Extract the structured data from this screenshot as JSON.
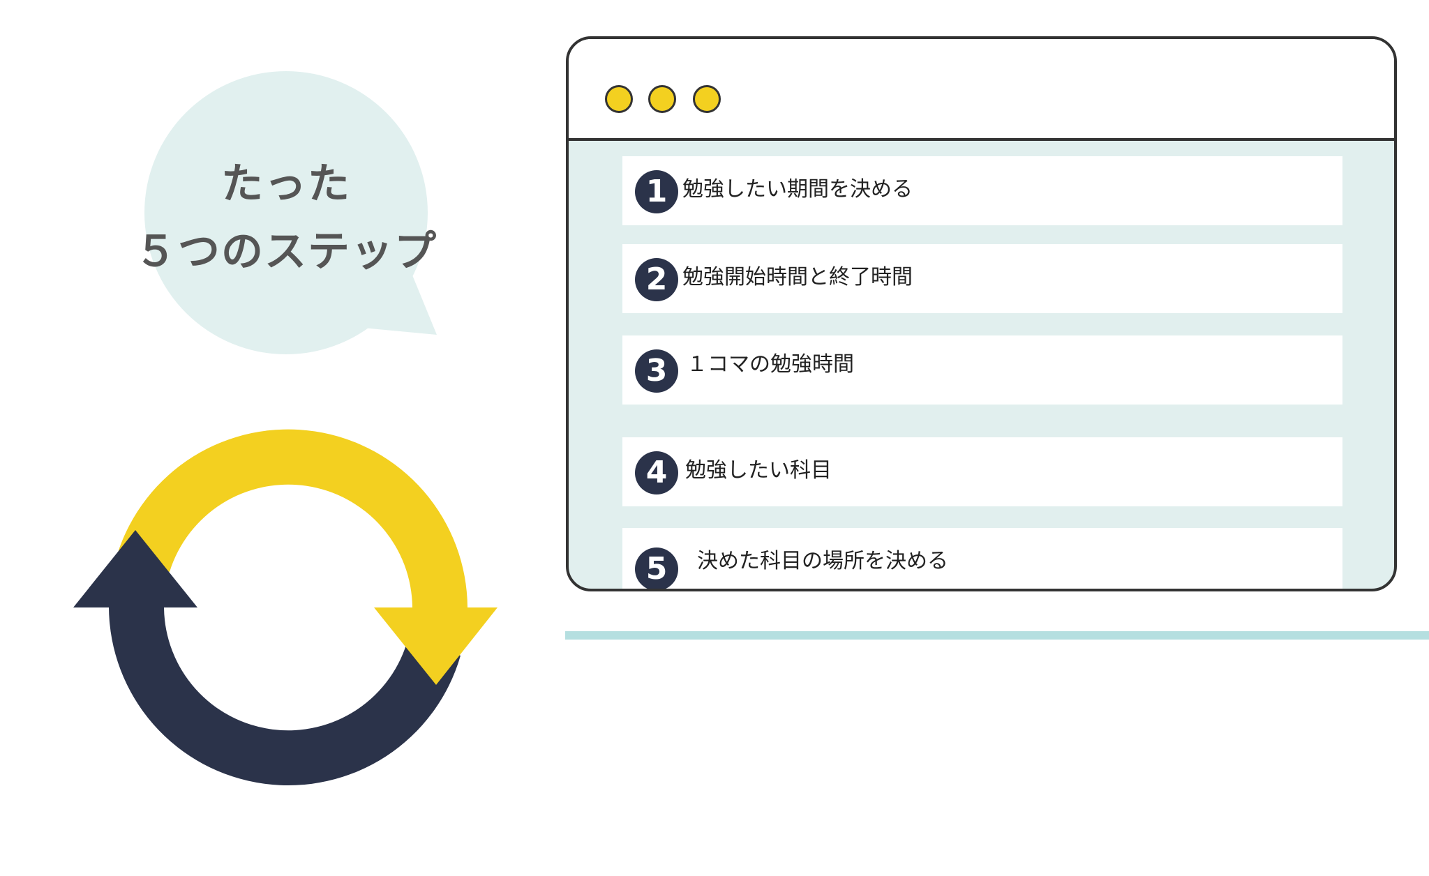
{
  "bubble": {
    "line1": "たった",
    "line2": "５つのステップ"
  },
  "steps": [
    {
      "number": "1",
      "label": "勉強したい期間を決める"
    },
    {
      "number": "2",
      "label": "勉強開始時間と終了時間"
    },
    {
      "number": "3",
      "label": "１コマの勉強時間"
    },
    {
      "number": "4",
      "label": "勉強したい科目"
    },
    {
      "number": "5",
      "label": "決めた科目の場所を決める"
    }
  ],
  "colors": {
    "yellow": "#f3d020",
    "navy": "#2b334a",
    "bubble": "#e1f0ef",
    "teal": "#b5dfe0"
  }
}
